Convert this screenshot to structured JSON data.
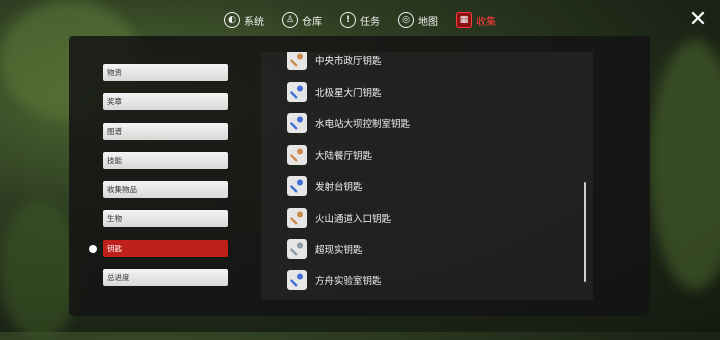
{
  "nav": {
    "tabs": [
      {
        "label": "系统",
        "icon": "system-icon"
      },
      {
        "label": "仓库",
        "icon": "warehouse-icon"
      },
      {
        "label": "任务",
        "icon": "task-icon"
      },
      {
        "label": "地图",
        "icon": "map-icon"
      },
      {
        "label": "收集",
        "icon": "collection-icon"
      }
    ],
    "active_tab": "收集",
    "close_icon": "close-icon",
    "accent_color": "#ff3b3b"
  },
  "sidebar": {
    "categories": [
      {
        "label": "物资"
      },
      {
        "label": "奖章"
      },
      {
        "label": "图谱"
      },
      {
        "label": "技能"
      },
      {
        "label": "收集物品"
      },
      {
        "label": "生物"
      },
      {
        "label": "钥匙"
      },
      {
        "label": "总进度"
      }
    ],
    "selected": "钥匙",
    "selected_color": "#c0201b"
  },
  "keys": {
    "items": [
      {
        "label": "中央市政厅钥匙",
        "icon": "gold-key-icon",
        "color": "#c98a4b"
      },
      {
        "label": "北极星大门钥匙",
        "icon": "blue-key-icon",
        "color": "#3f6fd6"
      },
      {
        "label": "水电站大坝控制室钥匙",
        "icon": "blue-key-icon",
        "color": "#3f6fd6"
      },
      {
        "label": "大陆餐厅钥匙",
        "icon": "gold-key-icon",
        "color": "#c98a4b"
      },
      {
        "label": "发射台钥匙",
        "icon": "blue-key-icon",
        "color": "#3f6fd6"
      },
      {
        "label": "火山通道入口钥匙",
        "icon": "gold-key-icon",
        "color": "#c98a4b"
      },
      {
        "label": "超现实钥匙",
        "icon": "silver-key-icon",
        "color": "#8a9aa6"
      },
      {
        "label": "方舟实验室钥匙",
        "icon": "blue-key-icon",
        "color": "#3f6fd6"
      }
    ]
  }
}
